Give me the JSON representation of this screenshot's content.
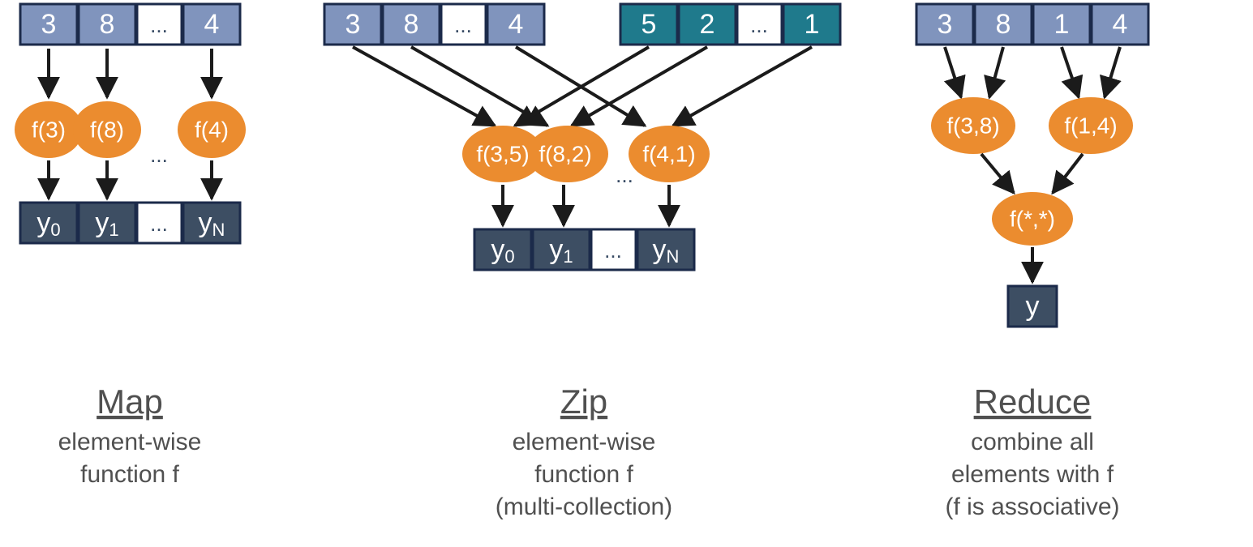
{
  "colors": {
    "array_light": "#8094BD",
    "array_teal": "#1F7A8C",
    "array_dark": "#3D4E63",
    "cell_border": "#1B2A4A",
    "ellipse": "#EB8C2F",
    "arrow": "#1B1B1B",
    "text_gray": "#505050"
  },
  "panels": {
    "map": {
      "title": "Map",
      "desc_lines": [
        "element-wise",
        "function f"
      ],
      "input": [
        "3",
        "8",
        "...",
        "4"
      ],
      "ops": [
        "f(3)",
        "f(8)",
        "f(4)"
      ],
      "ops_dots": "...",
      "output": [
        "y0",
        "y1",
        "...",
        "yN"
      ]
    },
    "zip": {
      "title": "Zip",
      "desc_lines": [
        "element-wise",
        "function f",
        "(multi-collection)"
      ],
      "input_a": [
        "3",
        "8",
        "...",
        "4"
      ],
      "input_b": [
        "5",
        "2",
        "...",
        "1"
      ],
      "ops": [
        "f(3,5)",
        "f(8,2)",
        "f(4,1)"
      ],
      "ops_dots": "...",
      "output": [
        "y0",
        "y1",
        "...",
        "yN"
      ]
    },
    "reduce": {
      "title": "Reduce",
      "desc_lines": [
        "combine all",
        "elements with f",
        "(f is associative)"
      ],
      "input": [
        "3",
        "8",
        "1",
        "4"
      ],
      "ops_level1": [
        "f(3,8)",
        "f(1,4)"
      ],
      "op_level2": "f(*,*)",
      "output": "y"
    }
  }
}
